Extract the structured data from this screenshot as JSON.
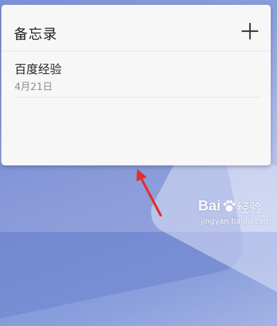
{
  "widget": {
    "title": "备忘录",
    "add_icon": "plus-icon"
  },
  "notes": [
    {
      "title": "百度经验",
      "date": "4月21日"
    }
  ],
  "annotation": {
    "arrow_icon": "red-arrow",
    "arrow_color": "#e0302b"
  },
  "watermark": {
    "logo_prefix": "Bai",
    "logo_suffix": "经验",
    "url": "jingyan.baidu.com"
  },
  "colors": {
    "widget_bg": "#f7f7f8",
    "wallpaper": "#8a9fdc"
  }
}
